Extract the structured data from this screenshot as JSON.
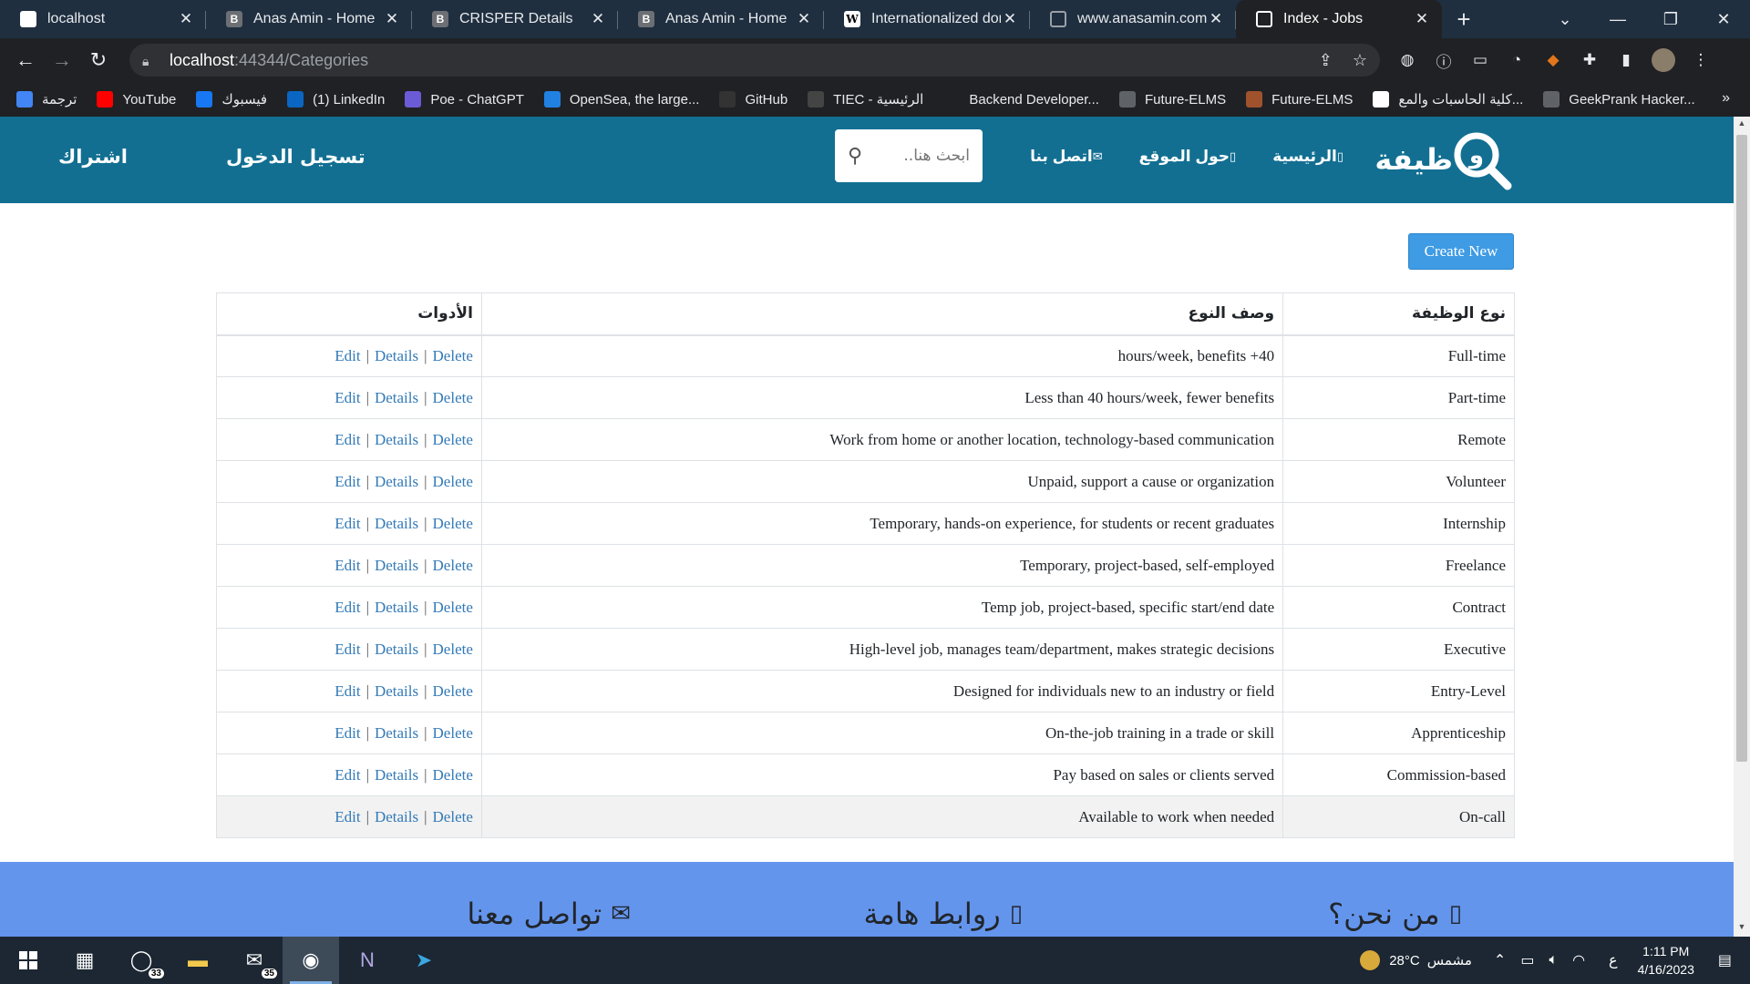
{
  "browser": {
    "tabs": [
      {
        "title": "localhost",
        "favicon": "doc"
      },
      {
        "title": "Anas Amin - Home",
        "favicon": "B"
      },
      {
        "title": "CRISPER Details",
        "favicon": "B"
      },
      {
        "title": "Anas Amin - Home",
        "favicon": "B"
      },
      {
        "title": "Internationalized dom",
        "favicon": "W"
      },
      {
        "title": "www.anasamin.com",
        "favicon": "globe"
      },
      {
        "title": "Index - Jobs",
        "favicon": "globe",
        "active": true
      }
    ],
    "url_host": "localhost",
    "url_rest": ":44344/Categories",
    "bookmarks": [
      {
        "label": "ترجمة",
        "color": "#4285f4"
      },
      {
        "label": "YouTube",
        "color": "#ff0000"
      },
      {
        "label": "فيسبوك",
        "color": "#1877f2"
      },
      {
        "label": "(1) LinkedIn",
        "color": "#0a66c2"
      },
      {
        "label": "Poe - ChatGPT",
        "color": "#6b5bd6"
      },
      {
        "label": "OpenSea, the large...",
        "color": "#2081e2"
      },
      {
        "label": "GitHub",
        "color": "#333333"
      },
      {
        "label": "TIEC - الرئيسية",
        "color": "#444444"
      },
      {
        "label": "Backend Developer...",
        "color": "#202124"
      },
      {
        "label": "Future-ELMS",
        "color": "#5f6368"
      },
      {
        "label": "Future-ELMS",
        "color": "#a0522d"
      },
      {
        "label": "كلية الحاسبات والمع...",
        "color": "#ffffff"
      },
      {
        "label": "GeekPrank Hacker...",
        "color": "#5f6368"
      }
    ]
  },
  "site": {
    "brand": "ظيفة",
    "nav": {
      "home": "الرئيسية",
      "about": "حول الموقع",
      "contact": "اتصل بنا"
    },
    "search_placeholder": "ابحث هنا..",
    "login": "تسجيل الدخول",
    "register": "اشتراك",
    "create_new": "Create New",
    "table": {
      "headers": {
        "type": "نوع الوظيفة",
        "desc": "وصف النوع",
        "tools": "الأدوات"
      },
      "actions": {
        "edit": "Edit",
        "details": "Details",
        "delete": "Delete"
      },
      "rows": [
        {
          "type": "Full-time",
          "desc": "40+ hours/week, benefits"
        },
        {
          "type": "Part-time",
          "desc": "Less than 40 hours/week, fewer benefits"
        },
        {
          "type": "Remote",
          "desc": "Work from home or another location, technology-based communication"
        },
        {
          "type": "Volunteer",
          "desc": "Unpaid, support a cause or organization"
        },
        {
          "type": "Internship",
          "desc": "Temporary, hands-on experience, for students or recent graduates"
        },
        {
          "type": "Freelance",
          "desc": "Temporary, project-based, self-employed"
        },
        {
          "type": "Contract",
          "desc": "Temp job, project-based, specific start/end date"
        },
        {
          "type": "Executive",
          "desc": "High-level job, manages team/department, makes strategic decisions"
        },
        {
          "type": "Entry-Level",
          "desc": "Designed for individuals new to an industry or field"
        },
        {
          "type": "Apprenticeship",
          "desc": "On-the-job training in a trade or skill"
        },
        {
          "type": "Commission-based",
          "desc": "Pay based on sales or clients served"
        },
        {
          "type": "On-call",
          "desc": "Available to work when needed"
        }
      ]
    },
    "footer": {
      "about": "من نحن؟",
      "links": "روابط هامة",
      "contact": "تواصل معنا"
    }
  },
  "taskbar": {
    "badges": {
      "whatsapp": "33",
      "mail": "35"
    },
    "weather": "28°C",
    "weather_desc": "مشمس",
    "lang": "ع",
    "time": "1:11 PM",
    "date": "4/16/2023"
  },
  "colors": {
    "navbar": "#126f92",
    "footer": "#6495ed",
    "create_button": "#3e9be4",
    "link": "#337ab7"
  }
}
